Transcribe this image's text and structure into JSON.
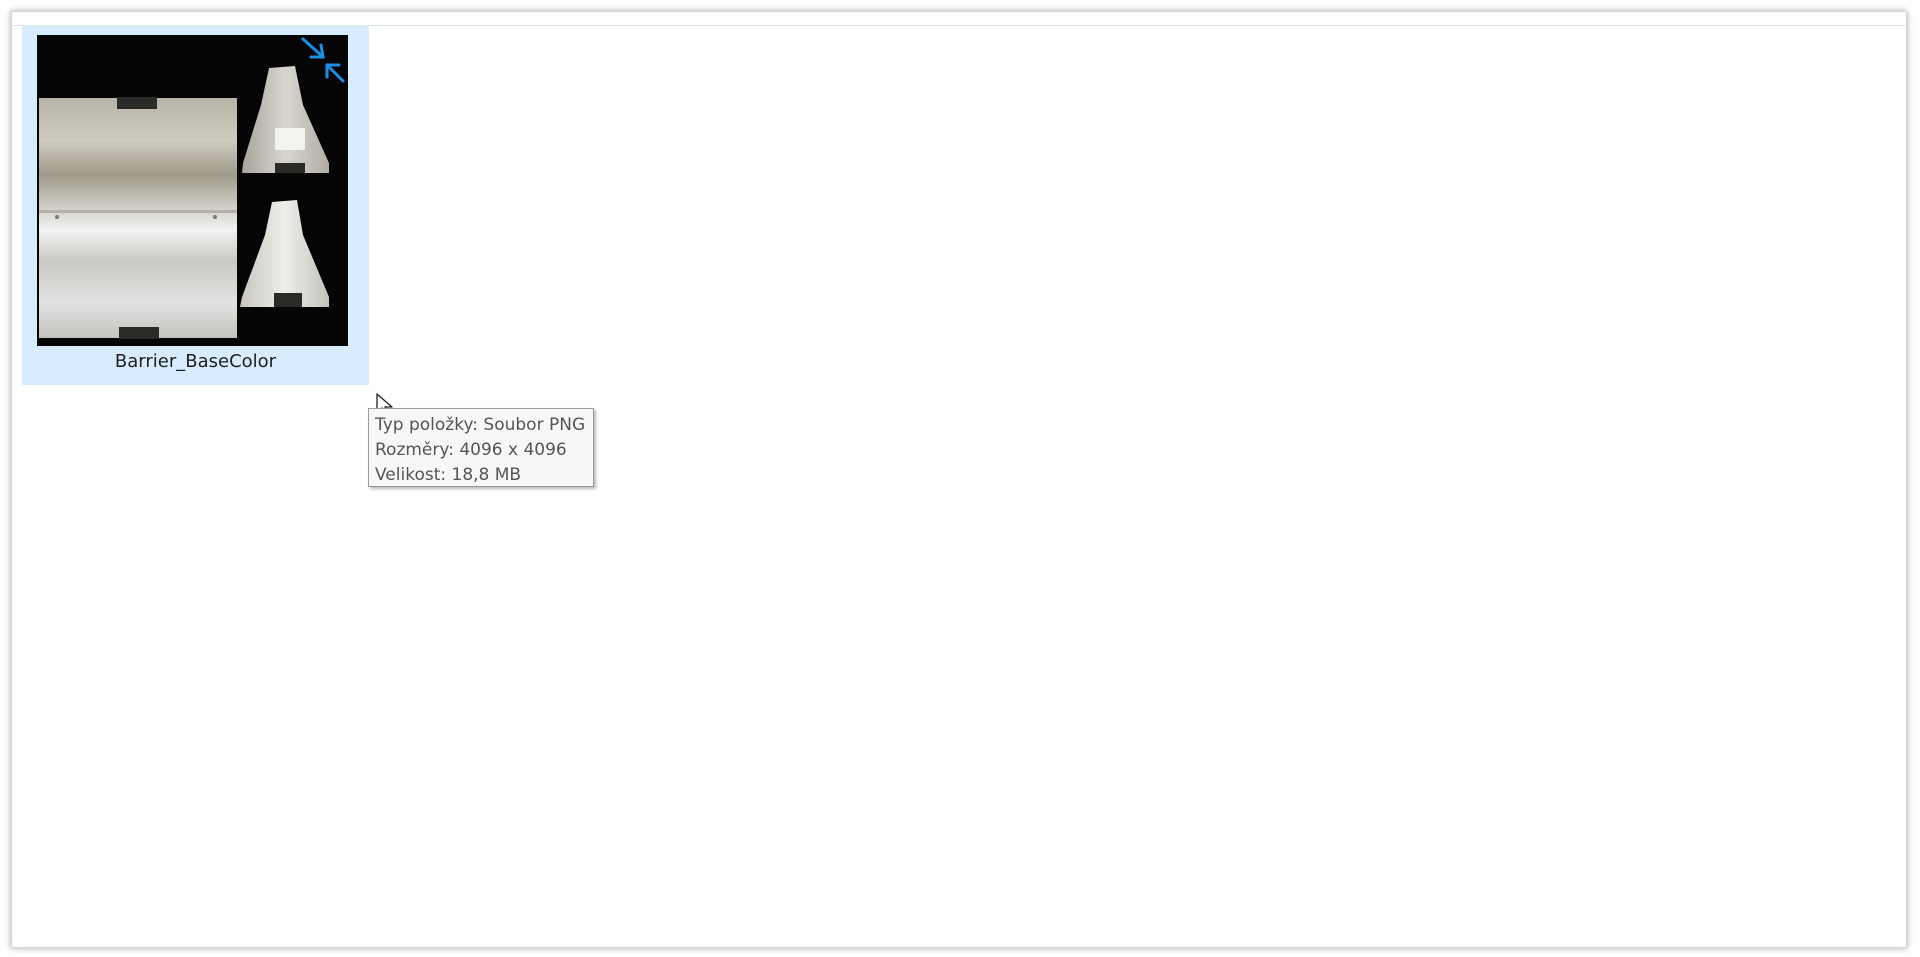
{
  "file": {
    "name": "Barrier_BaseColor",
    "thumbnail_icon": "texture-preview-icon",
    "overlay_icon": "compress-arrows-icon"
  },
  "tooltip": {
    "type": "Typ položky: Soubor PNG",
    "dimensions": "Rozměry: 4096 x 4096",
    "size": "Velikost: 18,8 MB"
  },
  "colors": {
    "selection": "#cce8ff",
    "overlay_icon": "#1a8fe3",
    "tooltip_bg": "#f7f7f7"
  }
}
